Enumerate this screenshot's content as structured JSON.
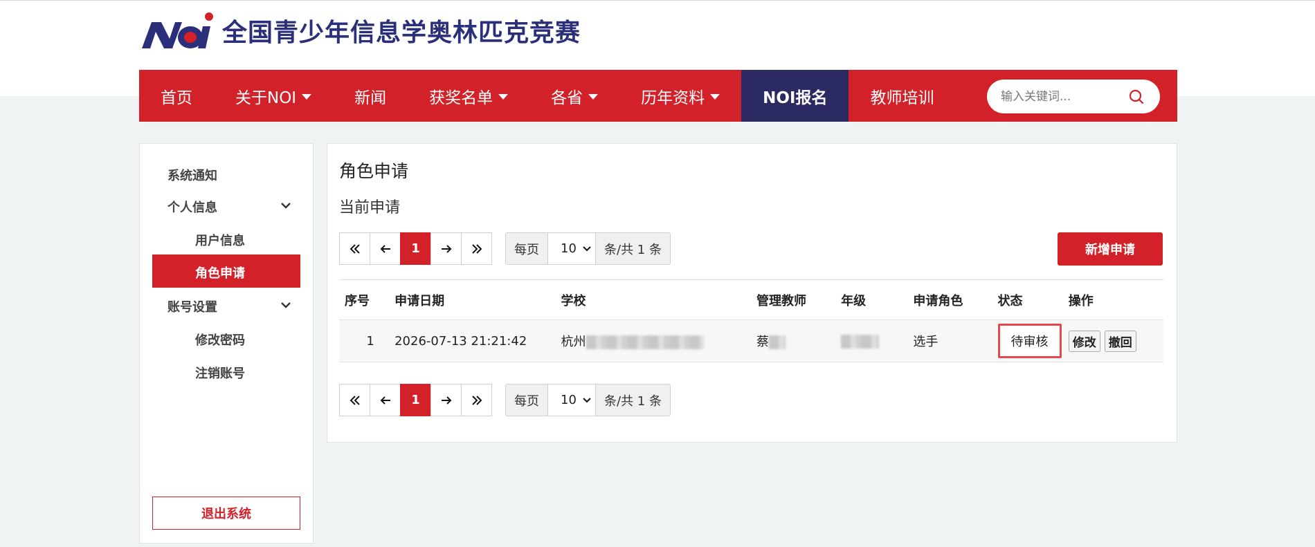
{
  "site": {
    "title": "全国青少年信息学奥林匹克竞赛",
    "logo_text": "NOI"
  },
  "nav": {
    "items": [
      {
        "label": "首页",
        "dropdown": false
      },
      {
        "label": "关于NOI",
        "dropdown": true
      },
      {
        "label": "新闻",
        "dropdown": false
      },
      {
        "label": "获奖名单",
        "dropdown": true
      },
      {
        "label": "各省",
        "dropdown": true
      },
      {
        "label": "历年资料",
        "dropdown": true
      },
      {
        "label": "NOI报名",
        "dropdown": false,
        "active": true
      },
      {
        "label": "教师培训",
        "dropdown": false
      }
    ],
    "search_placeholder": "输入关键词..."
  },
  "sidebar": {
    "notice": "系统通知",
    "personal": "个人信息",
    "user_info": "用户信息",
    "role_apply": "角色申请",
    "account": "账号设置",
    "change_pwd": "修改密码",
    "cancel_account": "注销账号",
    "logout": "退出系统"
  },
  "main": {
    "title": "角色申请",
    "subtitle": "当前申请",
    "new_button": "新增申请",
    "pager": {
      "current_page": "1",
      "per_page_label": "每页",
      "per_page_value": "10",
      "total_label": "条/共 1 条"
    },
    "table": {
      "headers": [
        "序号",
        "申请日期",
        "学校",
        "管理教师",
        "年级",
        "申请角色",
        "状态",
        "操作"
      ],
      "rows": [
        {
          "index": "1",
          "date": "2026-07-13 21:21:42",
          "school": "杭州",
          "teacher": "蔡",
          "grade": "",
          "role": "选手",
          "status": "待审核",
          "actions": [
            "修改",
            "撤回"
          ]
        }
      ]
    }
  },
  "colors": {
    "brand_red": "#d32129",
    "nav_active": "#2b2a63",
    "highlight": "#e8464d"
  }
}
